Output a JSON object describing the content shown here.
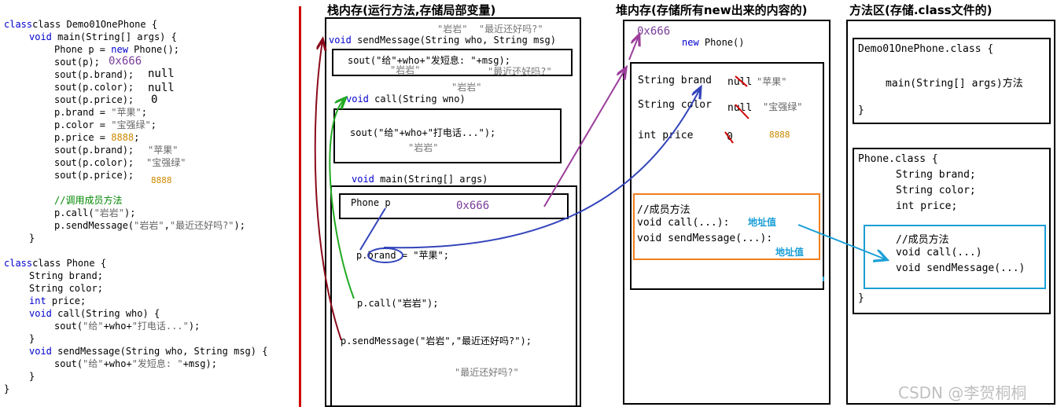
{
  "code": {
    "l1": "class Demo01OnePhone {",
    "l2a": "void",
    "l2b": " main(String[] args) {",
    "l3a": "Phone p = ",
    "l3b": "new",
    "l3c": " Phone();",
    "l4": "sout(p);",
    "l5": "sout(p.brand);",
    "l6": "sout(p.color);",
    "l7": "sout(p.price);",
    "l8a": "p.brand = ",
    "l8b": "\"苹果\"",
    "l8c": ";",
    "l9a": "p.color = ",
    "l9b": "\"宝强绿\"",
    "l9c": ";",
    "l10a": "p.price = ",
    "l10b": "8888",
    "l10c": ";",
    "l11": "sout(p.brand);",
    "l12": "sout(p.color);",
    "l13": "sout(p.price);",
    "l14": "//调用成员方法",
    "l15a": "p.call(",
    "l15b": "\"岩岩\"",
    "l15c": ");",
    "l16a": "p.sendMessage(",
    "l16b": "\"岩岩\"",
    "l16c": ",",
    "l16d": "\"最近还好吗?\"",
    "l16e": ");",
    "l17": "}",
    "l18": "class Phone {",
    "l19": "String brand;",
    "l20": "String color;",
    "l21a": "int",
    "l21b": " price;",
    "l22a": "void",
    "l22b": " call(String who) {",
    "l23a": "sout(",
    "l23b": "\"给\"",
    "l23c": "+who+",
    "l23d": "\"打电话...\"",
    "l23e": ");",
    "l24": "}",
    "l25a": "void",
    "l25b": " sendMessage(String who, String msg) {",
    "l26a": "sout(",
    "l26b": "\"给\"",
    "l26c": "+who+",
    "l26d": "\"发短息: \"",
    "l26e": "+msg);",
    "l27": "}",
    "l28": "}"
  },
  "code_annotations": {
    "addr": "0x666",
    "null1": "null",
    "null2": "null",
    "zero": "0",
    "brand_val": "\"苹果\"",
    "color_val": "\"宝强绿\"",
    "price_val": "8888"
  },
  "stack": {
    "title": "栈内存(运行方法,存储局部变量)",
    "send_args_top": "\"岩岩\"  \"最近还好吗?\"",
    "send_sig_a": "void",
    "send_sig_b": " sendMessage(String who, String msg)",
    "sout_msg": "sout(\"给\"+who+\"发短息: \"+msg);",
    "sout_msg_who": "\"岩岩\"",
    "sout_msg_msg": "\"最近还好吗?\"",
    "call_arg_top": "\"岩岩\"",
    "call_sig_a": "void",
    "call_sig_b": " call(String wno)",
    "sout_call": "sout(\"给\"+who+\"打电话...\");",
    "sout_call_who": "\"岩岩\"",
    "main_sig_a": "void",
    "main_sig_b": " main(String[] args)",
    "phone_p": "Phone p",
    "phone_p_addr": "0x666",
    "assign_a": "p.",
    "assign_b": "brand",
    "assign_c": " = \"苹果\";",
    "call_stmt": "p.call(\"岩岩\");",
    "send_stmt": "p.sendMessage(\"岩岩\",\"最近还好吗?\");",
    "bottom_msg": "\"最近还好吗?\""
  },
  "heap": {
    "title": "堆内存(存储所有new出来的内容的)",
    "addr": "0x666",
    "new_a": "new",
    "new_b": " Phone()",
    "brand_field": "String brand",
    "brand_null": "null",
    "brand_val": "\"苹果\"",
    "color_field": "String color",
    "color_null": "null",
    "color_val": "\"宝强绿\"",
    "price_field": "int price",
    "price_zero": "0",
    "price_val": "8888",
    "methods_comment": "//成员方法",
    "m_call": "void call(...):",
    "m_call_addr": "地址值",
    "m_send": "void sendMessage(...):",
    "m_send_addr": "地址值"
  },
  "method_area": {
    "title": "方法区(存储.class文件的)",
    "demo_class": "Demo01OnePhone.class {",
    "demo_main": "main(String[] args)方法",
    "demo_close": "}",
    "phone_class": "Phone.class {",
    "f_brand": "String brand;",
    "f_color": "String color;",
    "f_price": "int price;",
    "methods_comment": "//成员方法",
    "m_call": "void call(...)",
    "m_send": "void sendMessage(...)",
    "phone_close": "}"
  },
  "watermark": "CSDN @李贺桐桐",
  "colors": {
    "keyword": "#0000cc",
    "string": "#666666",
    "number": "#cc8800",
    "comment": "#008800",
    "divider": "#d00000",
    "arrow_darkred": "#8b0a1a",
    "arrow_green": "#22aa22",
    "arrow_purple": "#9b3d9b",
    "arrow_blue": "#3344bb",
    "arrow_cyan": "#1a9fd6",
    "orange_box": "#f08020",
    "cyan_box": "#1a9fd6"
  }
}
